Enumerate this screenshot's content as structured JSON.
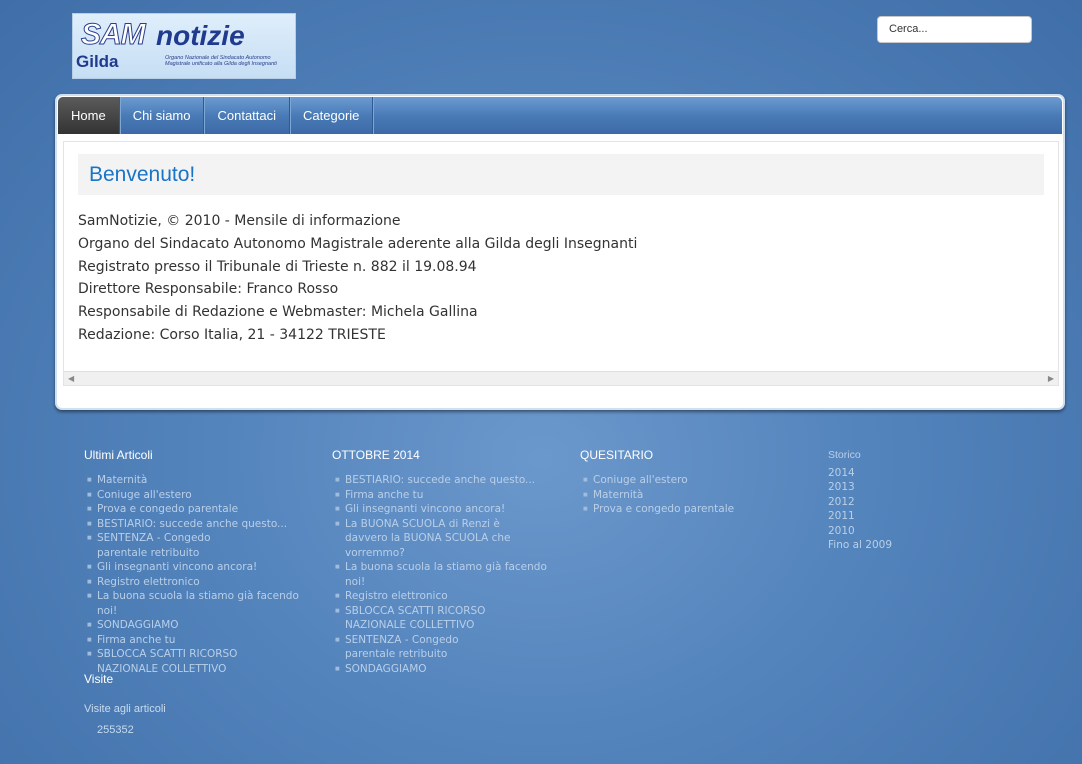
{
  "logo": {
    "brand_part1": "SAM",
    "brand_part2": "notizie",
    "gilda": "Gilda",
    "subtitle": "Organo Nazionale del Sindacato Autonomo Magistrale unificato alla Gilda degli Insegnanti"
  },
  "search": {
    "placeholder": "Cerca..."
  },
  "nav": {
    "items": [
      {
        "label": "Home"
      },
      {
        "label": "Chi siamo"
      },
      {
        "label": "Contattaci"
      },
      {
        "label": "Categorie"
      }
    ]
  },
  "main": {
    "title": "Benvenuto!",
    "lines": [
      "SamNotizie, © 2010 - Mensile di informazione",
      "Organo del Sindacato Autonomo Magistrale aderente alla Gilda degli Insegnanti",
      "Registrato presso il Tribunale di Trieste n. 882 il 19.08.94",
      "Direttore Responsabile: Franco Rosso",
      "Responsabile di Redazione e Webmaster: Michela Gallina",
      "Redazione: Corso Italia, 21 - 34122 TRIESTE"
    ]
  },
  "footer": {
    "ultimi": {
      "title": "Ultimi Articoli",
      "items": [
        "Maternità",
        "Coniuge all'estero",
        "Prova e congedo parentale",
        "BESTIARIO: succede anche questo...",
        "SENTENZA - Congedo parentale retribuito",
        "Gli insegnanti vincono ancora!",
        "Registro elettronico",
        "La buona scuola la stiamo già facendo noi!",
        "SONDAGGIAMO",
        "Firma anche tu",
        "SBLOCCA SCATTI RICORSO NAZIONALE COLLETTIVO"
      ]
    },
    "ottobre": {
      "title": "OTTOBRE 2014",
      "items": [
        "BESTIARIO: succede anche questo...",
        "Firma anche tu",
        "Gli insegnanti vincono ancora!",
        "La BUONA SCUOLA di Renzi è davvero la BUONA SCUOLA che vorremmo?",
        "La buona scuola la stiamo già facendo noi!",
        "Registro elettronico",
        "SBLOCCA SCATTI RICORSO NAZIONALE COLLETTIVO",
        "SENTENZA - Congedo parentale retribuito",
        "SONDAGGIAMO"
      ]
    },
    "questiario": {
      "title": "QUESITARIO",
      "items": [
        "Coniuge all'estero",
        "Maternità",
        "Prova e congedo parentale"
      ]
    },
    "storico": {
      "title": "Storico",
      "items": [
        "2014",
        "2013",
        "2012",
        "2011",
        "2010",
        "Fino al 2009"
      ]
    },
    "visits": {
      "title": "Visite",
      "subtitle": "Visite agli articoli",
      "count": "255352"
    }
  }
}
